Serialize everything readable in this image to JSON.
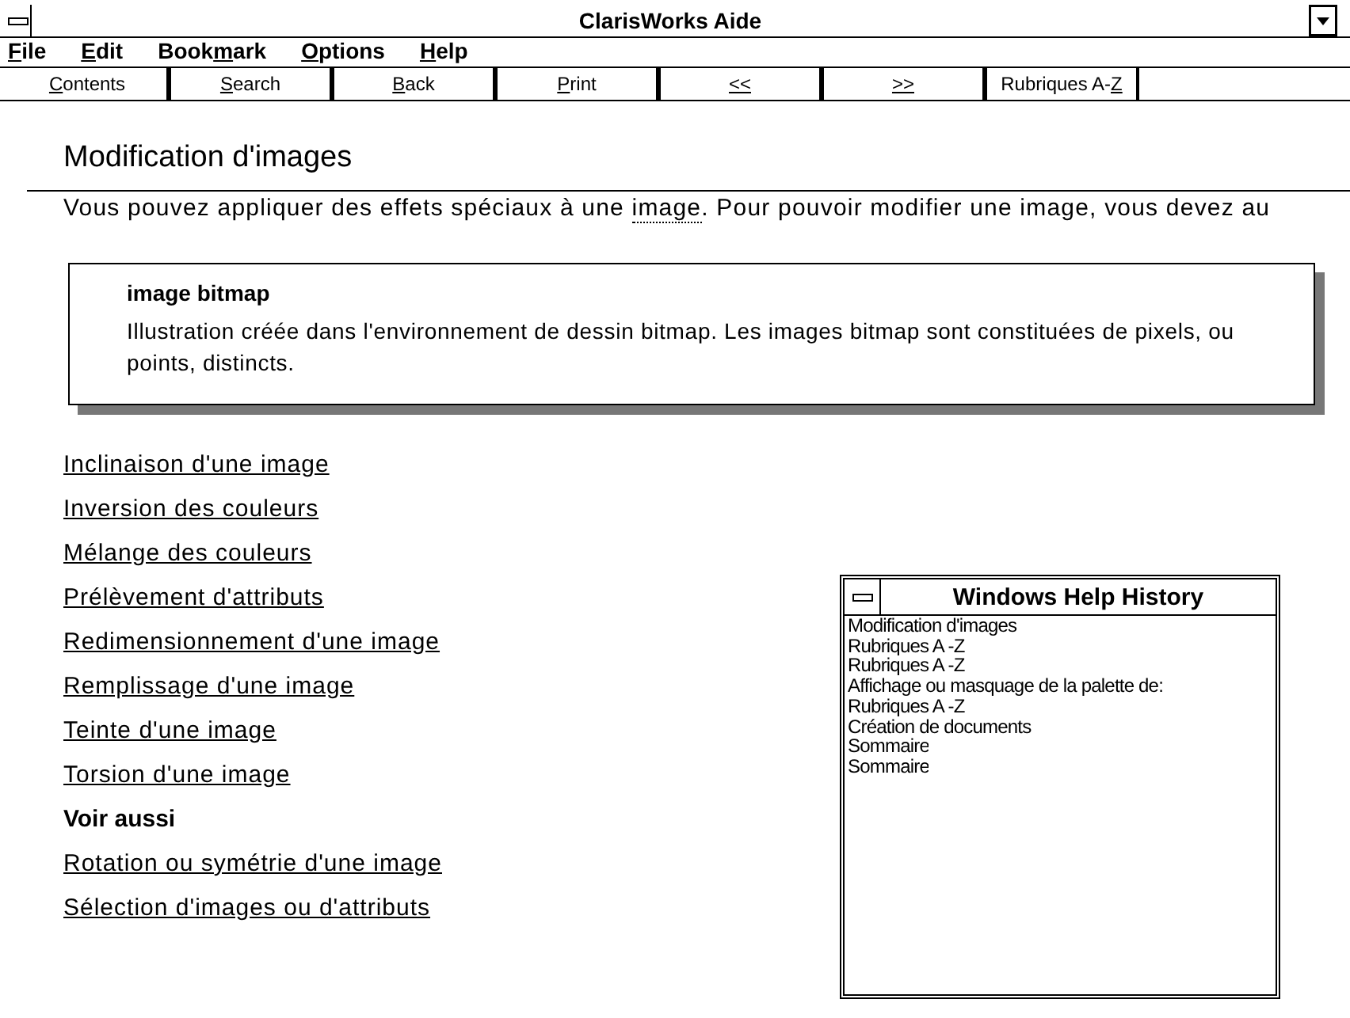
{
  "window": {
    "title": "ClarisWorks Aide"
  },
  "menu": [
    {
      "segments": [
        {
          "text": "F",
          "underline": true
        },
        {
          "text": "ile",
          "underline": false
        }
      ]
    },
    {
      "segments": [
        {
          "text": "E",
          "underline": true
        },
        {
          "text": "dit",
          "underline": false
        }
      ]
    },
    {
      "segments": [
        {
          "text": "Book",
          "underline": false
        },
        {
          "text": "m",
          "underline": true
        },
        {
          "text": "ark",
          "underline": false
        }
      ]
    },
    {
      "segments": [
        {
          "text": "O",
          "underline": true
        },
        {
          "text": "ptions",
          "underline": false
        }
      ]
    },
    {
      "segments": [
        {
          "text": "H",
          "underline": true
        },
        {
          "text": "elp",
          "underline": false
        }
      ]
    }
  ],
  "buttons": [
    {
      "segments": [
        {
          "text": "C",
          "underline": true
        },
        {
          "text": "ontents",
          "underline": false
        }
      ]
    },
    {
      "segments": [
        {
          "text": "S",
          "underline": true
        },
        {
          "text": "earch",
          "underline": false
        }
      ]
    },
    {
      "segments": [
        {
          "text": "B",
          "underline": true
        },
        {
          "text": "ack",
          "underline": false
        }
      ]
    },
    {
      "segments": [
        {
          "text": "P",
          "underline": true
        },
        {
          "text": "rint",
          "underline": false
        }
      ]
    },
    {
      "segments": [
        {
          "text": "<<",
          "underline": true
        }
      ]
    },
    {
      "segments": [
        {
          "text": ">>",
          "underline": true
        }
      ]
    },
    {
      "segments": [
        {
          "text": "Rubriques A-",
          "underline": false
        },
        {
          "text": "Z",
          "underline": true
        }
      ]
    }
  ],
  "topic": {
    "heading": "Modification d'images",
    "intro": [
      {
        "kind": "text",
        "text": "Vous pouvez appliquer des effets spéciaux à une "
      },
      {
        "kind": "link",
        "text": "image"
      },
      {
        "kind": "text",
        "text": ". Pour pouvoir modifier une image, vous devez au"
      }
    ],
    "links": [
      "Inclinaison d'une image",
      "Inversion des couleurs",
      "Mélange des couleurs",
      "Prélèvement d'attributs",
      "Redimensionnement d'une image",
      "Remplissage d'une image",
      "Teinte d'une image",
      "Torsion d'une image"
    ],
    "see_also": {
      "title": "Voir aussi",
      "links": [
        "Rotation ou symétrie d'une image",
        "Sélection d'images ou d'attributs"
      ]
    }
  },
  "popup": {
    "term": "image bitmap",
    "definition": "Illustration créée dans l'environnement de dessin bitmap. Les images bitmap sont constituées de pixels, ou points, distincts."
  },
  "history": {
    "title": "Windows Help History",
    "items": [
      "Modification d'images",
      "Rubriques A -Z",
      "Rubriques A -Z",
      "Affichage ou masquage de la palette de:",
      "Rubriques A -Z",
      "Création de documents",
      "Sommaire",
      "Sommaire"
    ]
  }
}
